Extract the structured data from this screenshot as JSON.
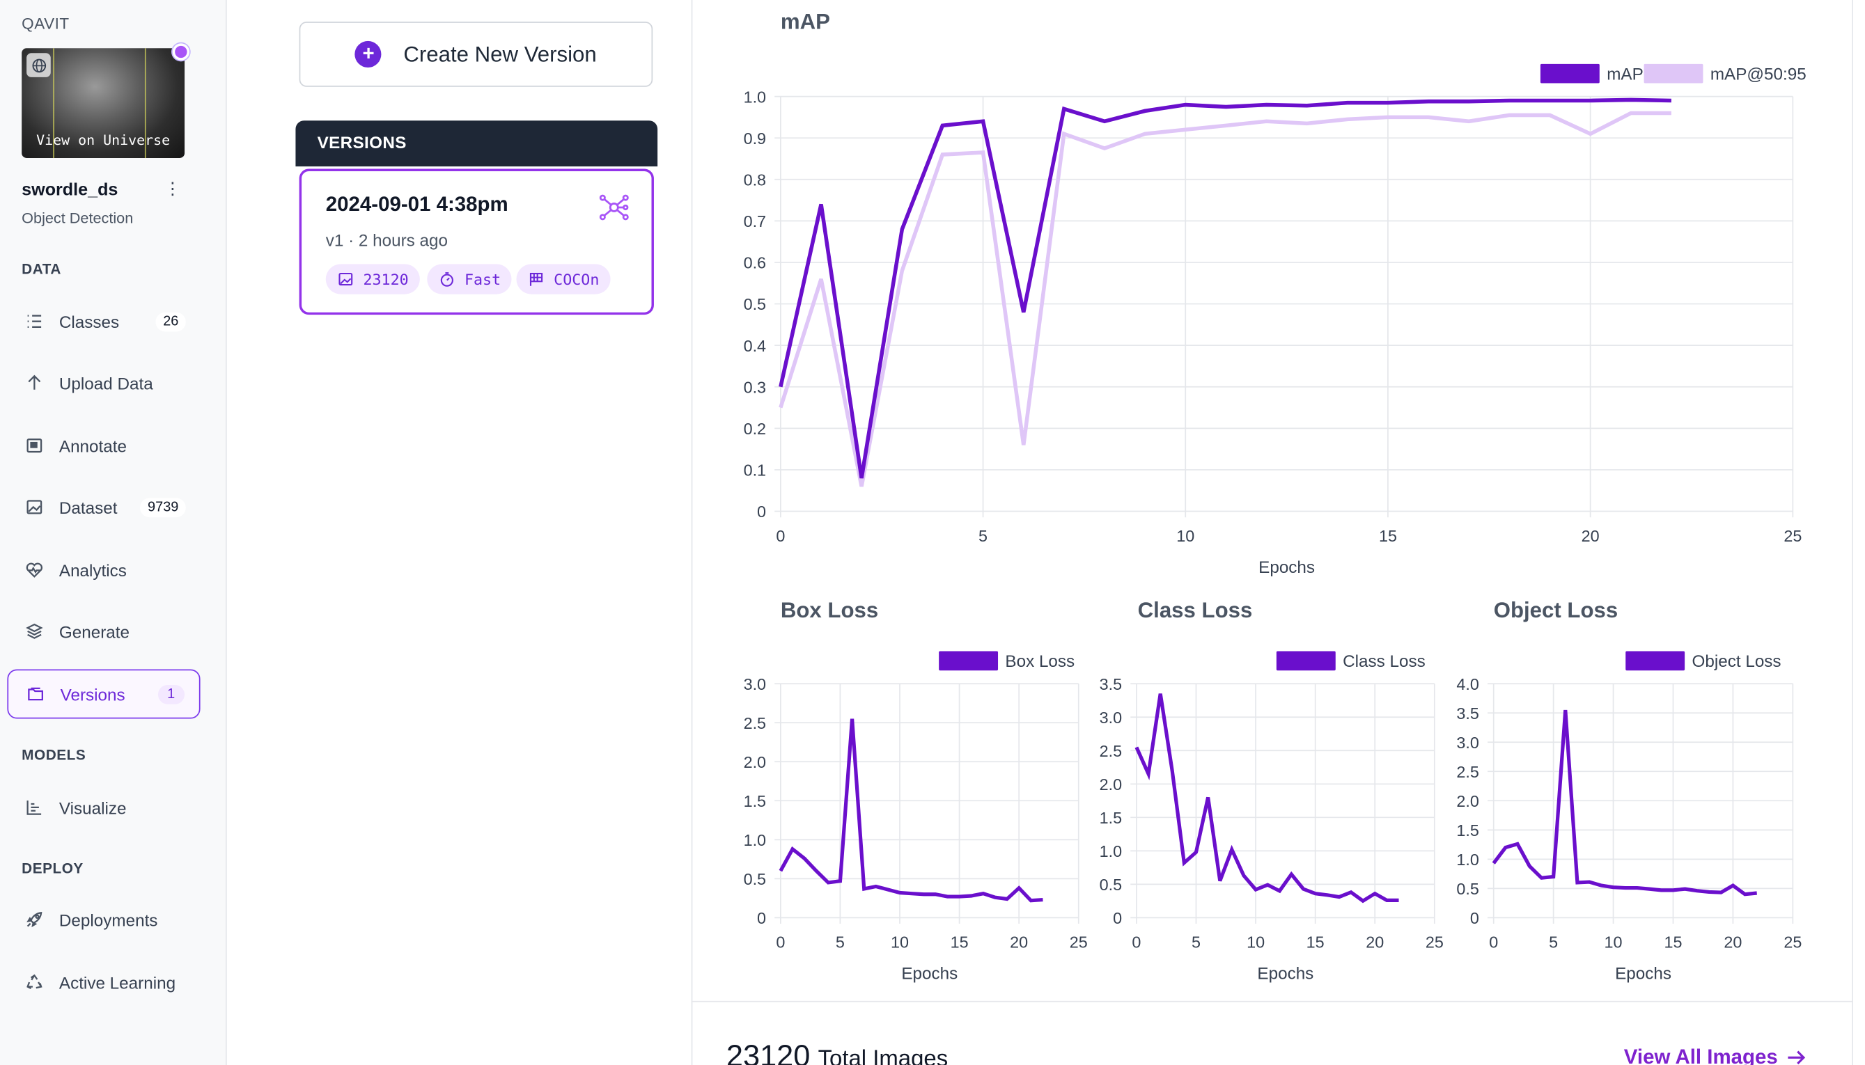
{
  "sidebar": {
    "workspace": "QAVIT",
    "thumbnail_label": "View on Universe",
    "project_name": "swordle_ds",
    "project_type": "Object Detection",
    "sections": {
      "data": "DATA",
      "models": "MODELS",
      "deploy": "DEPLOY"
    },
    "items": [
      {
        "label": "Classes",
        "count": "26",
        "icon": "list-icon"
      },
      {
        "label": "Upload Data",
        "icon": "upload-arrow-icon"
      },
      {
        "label": "Annotate",
        "icon": "annotate-icon"
      },
      {
        "label": "Dataset",
        "count": "9739",
        "icon": "image-icon"
      },
      {
        "label": "Analytics",
        "icon": "heart-pulse-icon"
      },
      {
        "label": "Generate",
        "icon": "layers-icon"
      },
      {
        "label": "Versions",
        "count": "1",
        "icon": "folder-icon",
        "active": true
      },
      {
        "label": "Visualize",
        "icon": "chart-icon"
      },
      {
        "label": "Deployments",
        "icon": "rocket-icon"
      },
      {
        "label": "Active Learning",
        "icon": "recycle-icon"
      }
    ]
  },
  "main": {
    "create_button": "Create New Version",
    "versions_header": "VERSIONS",
    "version": {
      "date": "2024-09-01 4:38pm",
      "subtitle": "v1 · 2 hours ago",
      "chips": {
        "images": "23120",
        "speed": "Fast",
        "format": "COCOn"
      }
    }
  },
  "totals": {
    "count": "23120",
    "label": "Total Images",
    "view_all": "View All Images"
  },
  "colors": {
    "accent": "#6a0fcc",
    "accent_light": "#dfc6f7",
    "header_dark": "#1e2736"
  },
  "chart_data": [
    {
      "type": "line",
      "title": "mAP",
      "xlabel": "Epochs",
      "ylabel": "",
      "xlim": [
        0,
        25
      ],
      "ylim": [
        0,
        1.0
      ],
      "xticks": [
        0,
        5,
        10,
        15,
        20,
        25
      ],
      "yticks": [
        0,
        0.1,
        0.2,
        0.3,
        0.4,
        0.5,
        0.6,
        0.7,
        0.8,
        0.9,
        1.0
      ],
      "legend": "top-right",
      "x": [
        0,
        1,
        2,
        3,
        4,
        5,
        6,
        7,
        8,
        9,
        10,
        11,
        12,
        13,
        14,
        15,
        16,
        17,
        18,
        19,
        20,
        21,
        22
      ],
      "series": [
        {
          "name": "mAP",
          "color": "#6a0fcc",
          "values": [
            0.3,
            0.74,
            0.08,
            0.68,
            0.93,
            0.94,
            0.48,
            0.97,
            0.94,
            0.965,
            0.98,
            0.975,
            0.98,
            0.978,
            0.985,
            0.985,
            0.988,
            0.988,
            0.99,
            0.99,
            0.99,
            0.992,
            0.99
          ]
        },
        {
          "name": "mAP@50:95",
          "color": "#dfc6f7",
          "values": [
            0.25,
            0.56,
            0.06,
            0.58,
            0.86,
            0.865,
            0.16,
            0.91,
            0.875,
            0.91,
            0.92,
            0.93,
            0.94,
            0.935,
            0.945,
            0.95,
            0.95,
            0.94,
            0.955,
            0.955,
            0.91,
            0.96,
            0.96
          ]
        }
      ]
    },
    {
      "type": "line",
      "title": "Box Loss",
      "xlabel": "Epochs",
      "ylabel": "",
      "xlim": [
        0,
        25
      ],
      "ylim": [
        0,
        3.0
      ],
      "xticks": [
        0,
        5,
        10,
        15,
        20,
        25
      ],
      "yticks": [
        0,
        0.5,
        1.0,
        1.5,
        2.0,
        2.5,
        3.0
      ],
      "legend": "top-right",
      "x": [
        0,
        1,
        2,
        3,
        4,
        5,
        6,
        7,
        8,
        9,
        10,
        11,
        12,
        13,
        14,
        15,
        16,
        17,
        18,
        19,
        20,
        21,
        22
      ],
      "series": [
        {
          "name": "Box Loss",
          "color": "#6a0fcc",
          "values": [
            0.6,
            0.88,
            0.76,
            0.6,
            0.45,
            0.47,
            2.55,
            0.37,
            0.4,
            0.36,
            0.32,
            0.31,
            0.3,
            0.3,
            0.27,
            0.27,
            0.28,
            0.31,
            0.26,
            0.24,
            0.38,
            0.22,
            0.23
          ]
        }
      ]
    },
    {
      "type": "line",
      "title": "Class Loss",
      "xlabel": "Epochs",
      "ylabel": "",
      "xlim": [
        0,
        25
      ],
      "ylim": [
        0,
        3.5
      ],
      "xticks": [
        0,
        5,
        10,
        15,
        20,
        25
      ],
      "yticks": [
        0,
        0.5,
        1.0,
        1.5,
        2.0,
        2.5,
        3.0,
        3.5
      ],
      "legend": "top-right",
      "x": [
        0,
        1,
        2,
        3,
        4,
        5,
        6,
        7,
        8,
        9,
        10,
        11,
        12,
        13,
        14,
        15,
        16,
        17,
        18,
        19,
        20,
        21,
        22
      ],
      "series": [
        {
          "name": "Class Loss",
          "color": "#6a0fcc",
          "values": [
            2.55,
            2.15,
            3.35,
            2.2,
            0.82,
            0.98,
            1.8,
            0.55,
            1.02,
            0.63,
            0.42,
            0.49,
            0.4,
            0.65,
            0.43,
            0.36,
            0.34,
            0.31,
            0.38,
            0.25,
            0.36,
            0.26,
            0.26
          ]
        }
      ]
    },
    {
      "type": "line",
      "title": "Object Loss",
      "xlabel": "Epochs",
      "ylabel": "",
      "xlim": [
        0,
        25
      ],
      "ylim": [
        0,
        4.0
      ],
      "xticks": [
        0,
        5,
        10,
        15,
        20,
        25
      ],
      "yticks": [
        0,
        0.5,
        1.0,
        1.5,
        2.0,
        2.5,
        3.0,
        3.5,
        4.0
      ],
      "legend": "top-right",
      "x": [
        0,
        1,
        2,
        3,
        4,
        5,
        6,
        7,
        8,
        9,
        10,
        11,
        12,
        13,
        14,
        15,
        16,
        17,
        18,
        19,
        20,
        21,
        22
      ],
      "series": [
        {
          "name": "Object Loss",
          "color": "#6a0fcc",
          "values": [
            0.93,
            1.2,
            1.26,
            0.88,
            0.68,
            0.7,
            3.55,
            0.6,
            0.61,
            0.55,
            0.52,
            0.51,
            0.51,
            0.49,
            0.47,
            0.47,
            0.49,
            0.46,
            0.44,
            0.43,
            0.55,
            0.4,
            0.42
          ]
        }
      ]
    }
  ]
}
